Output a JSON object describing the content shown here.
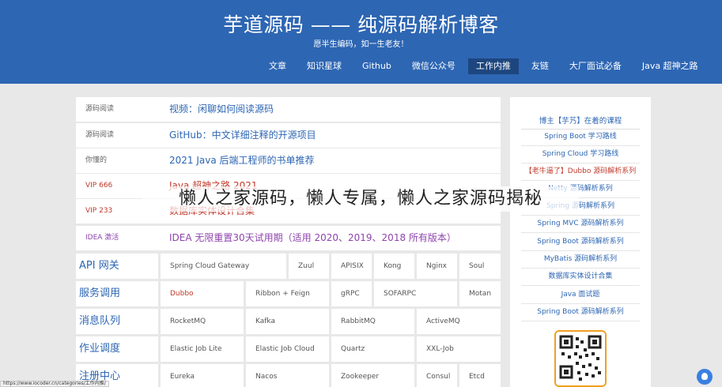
{
  "header": {
    "title": "芋道源码 —— 纯源码解析博客",
    "subtitle": "愿半生编码，如一生老友！",
    "nav": [
      "文章",
      "知识星球",
      "Github",
      "微信公众号",
      "工作内推",
      "友链",
      "大厂面试必备",
      "Java 超神之路"
    ],
    "active_nav": "工作内推"
  },
  "articles": [
    {
      "category": "源码阅读",
      "title": "视频：闲聊如何阅读源码"
    },
    {
      "category": "源码阅读",
      "title": "GitHub：中文详细注释的开源项目"
    },
    {
      "category": "你懂的",
      "title": "2021 Java 后端工程师的书单推荐"
    },
    {
      "category": "VIP 666",
      "title": "Java 超神之路 2021"
    },
    {
      "category": "VIP 233",
      "title": "数据库实体设计合集"
    },
    {
      "category": "IDEA 激活",
      "title": "IDEA 无限重置30天试用期（适用 2020、2019、2018 所有版本）"
    }
  ],
  "tech_grid": [
    {
      "label": "API 网关",
      "items": [
        "Spring Cloud Gateway",
        "Zuul",
        "APISIX",
        "Kong",
        "Nginx",
        "Soul"
      ]
    },
    {
      "label": "服务调用",
      "items": [
        "Dubbo",
        "Ribbon + Feign",
        "gRPC",
        "SOFARPC",
        "Motan"
      ]
    },
    {
      "label": "消息队列",
      "items": [
        "RocketMQ",
        "Kafka",
        "RabbitMQ",
        "ActiveMQ"
      ]
    },
    {
      "label": "作业调度",
      "items": [
        "Elastic Job Lite",
        "Elastic Job Cloud",
        "Quartz",
        "XXL-Job"
      ]
    },
    {
      "label": "注册中心",
      "items": [
        "Eureka",
        "Nacos",
        "Zookeeper",
        "Consul",
        "Etcd"
      ]
    }
  ],
  "sidebar": {
    "title": "博主【芋艿】在着的课程",
    "items": [
      "Spring Boot 学习路线",
      "Spring Cloud 学习路线",
      "【老牛逼了】Dubbo 源码解析系列",
      "Netty 源码解析系列",
      "Spring 源码解析系列",
      "Spring MVC 源码解析系列",
      "Spring Boot 源码解析系列",
      "MyBatis 源码解析系列",
      "数据库实体设计合集",
      "Java 面试题",
      "Spring Boot 源码解析系列"
    ]
  },
  "overlay": {
    "text": "懒人之家源码，懒人专属，懒人之家源码揭秘"
  },
  "status_bar": {
    "text": "https://www.iocoder.cn/categories/工作内推/"
  },
  "colors": {
    "header_bg": "#2d66b3",
    "link": "#2d66b3",
    "vip": "#c0392b",
    "idea": "#8e44ad"
  }
}
